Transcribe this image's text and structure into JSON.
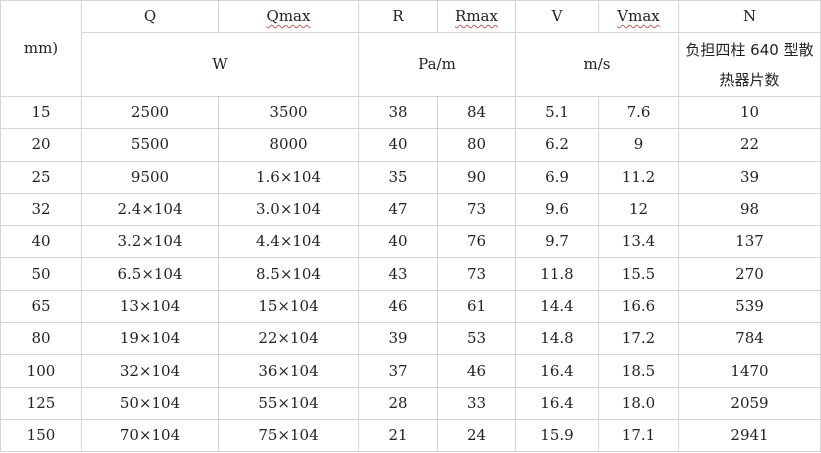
{
  "header": {
    "diameter_label": "mm)",
    "q": "Q",
    "qmax": "Qmax",
    "r": "R",
    "rmax": "Rmax",
    "v": "V",
    "vmax": "Vmax",
    "n": "N",
    "unit_w": "W",
    "unit_pa": "Pa/m",
    "unit_ms": "m/s",
    "n_desc": "负担四柱 640 型散热器片数"
  },
  "rows": [
    {
      "d": "15",
      "q": "2500",
      "qmax": "3500",
      "r": "38",
      "rmax": "84",
      "v": "5.1",
      "vmax": "7.6",
      "n": "10"
    },
    {
      "d": "20",
      "q": "5500",
      "qmax": "8000",
      "r": "40",
      "rmax": "80",
      "v": "6.2",
      "vmax": "9",
      "n": "22"
    },
    {
      "d": "25",
      "q": "9500",
      "qmax": "1.6×104",
      "r": "35",
      "rmax": "90",
      "v": "6.9",
      "vmax": "11.2",
      "n": "39"
    },
    {
      "d": "32",
      "q": "2.4×104",
      "qmax": "3.0×104",
      "r": "47",
      "rmax": "73",
      "v": "9.6",
      "vmax": "12",
      "n": "98"
    },
    {
      "d": "40",
      "q": "3.2×104",
      "qmax": "4.4×104",
      "r": "40",
      "rmax": "76",
      "v": "9.7",
      "vmax": "13.4",
      "n": "137"
    },
    {
      "d": "50",
      "q": "6.5×104",
      "qmax": "8.5×104",
      "r": "43",
      "rmax": "73",
      "v": "11.8",
      "vmax": "15.5",
      "n": "270"
    },
    {
      "d": "65",
      "q": "13×104",
      "qmax": "15×104",
      "r": "46",
      "rmax": "61",
      "v": "14.4",
      "vmax": "16.6",
      "n": "539"
    },
    {
      "d": "80",
      "q": "19×104",
      "qmax": "22×104",
      "r": "39",
      "rmax": "53",
      "v": "14.8",
      "vmax": "17.2",
      "n": "784"
    },
    {
      "d": "100",
      "q": "32×104",
      "qmax": "36×104",
      "r": "37",
      "rmax": "46",
      "v": "16.4",
      "vmax": "18.5",
      "n": "1470"
    },
    {
      "d": "125",
      "q": "50×104",
      "qmax": "55×104",
      "r": "28",
      "rmax": "33",
      "v": "16.4",
      "vmax": "18.0",
      "n": "2059"
    },
    {
      "d": "150",
      "q": "70×104",
      "qmax": "75×104",
      "r": "21",
      "rmax": "24",
      "v": "15.9",
      "vmax": "17.1",
      "n": "2941"
    }
  ]
}
